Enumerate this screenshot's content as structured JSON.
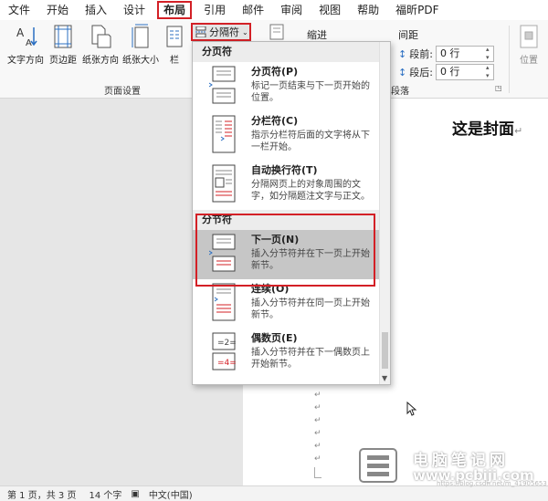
{
  "menubar": {
    "tabs": [
      "文件",
      "开始",
      "插入",
      "设计",
      "布局",
      "引用",
      "邮件",
      "审阅",
      "视图",
      "帮助",
      "福昕PDF"
    ],
    "active_tab": "布局"
  },
  "ribbon": {
    "buttons": {
      "text_direction": "文字方向",
      "margins": "页边距",
      "orientation": "纸张方向",
      "size": "纸张大小",
      "columns": "栏"
    },
    "breaks_label": "分隔符",
    "indent_label": "缩进",
    "spacing_label": "间距",
    "before_label": "段前:",
    "before_value": "0 行",
    "after_label": "段后:",
    "after_value": "0 行",
    "position_label": "位置",
    "group_page_setup": "页面设置",
    "group_paragraph": "段落"
  },
  "dropdown": {
    "page_breaks_heading": "分页符",
    "section_breaks_heading": "分节符",
    "items": [
      {
        "title": "分页符(P)",
        "desc": "标记一页结束与下一页开始的位置。"
      },
      {
        "title": "分栏符(C)",
        "desc": "指示分栏符后面的文字将从下一栏开始。"
      },
      {
        "title": "自动换行符(T)",
        "desc": "分隔网页上的对象周围的文字，如分隔题注文字与正文。"
      },
      {
        "title": "下一页(N)",
        "desc": "插入分节符并在下一页上开始新节。"
      },
      {
        "title": "连续(O)",
        "desc": "插入分节符并在同一页上开始新节。"
      },
      {
        "title": "偶数页(E)",
        "desc": "插入分节符并在下一偶数页上开始新节。"
      }
    ]
  },
  "document": {
    "cover_text": "这是封面",
    "para_mark": "↵"
  },
  "statusbar": {
    "page": "第 1 页，共 3 页",
    "words": "14 个字",
    "language": "中文(中国)"
  },
  "watermark": {
    "title": "电脑笔记网",
    "url": "www.pcbiji.com",
    "sub": "https://blog.csdn.net/m_41905653"
  },
  "colors": {
    "highlight_red": "#d32026",
    "hover_gray": "#c6c6c6",
    "arrow_blue": "#2b6fc2"
  }
}
